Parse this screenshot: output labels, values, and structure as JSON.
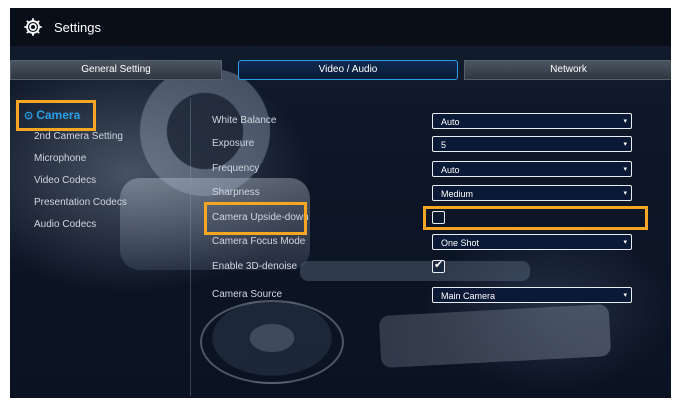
{
  "header": {
    "title": "Settings",
    "icon": "gear-icon"
  },
  "tabs": [
    {
      "label": "General Setting",
      "active": false
    },
    {
      "label": "Video / Audio",
      "active": true
    },
    {
      "label": "Network",
      "active": false
    }
  ],
  "sidebar": {
    "items": [
      {
        "label": "Camera",
        "active": true
      },
      {
        "label": "2nd Camera Setting",
        "active": false
      },
      {
        "label": "Microphone",
        "active": false
      },
      {
        "label": "Video Codecs",
        "active": false
      },
      {
        "label": "Presentation Codecs",
        "active": false
      },
      {
        "label": "Audio Codecs",
        "active": false
      }
    ]
  },
  "settings": [
    {
      "label": "White Balance",
      "type": "select",
      "value": "Auto"
    },
    {
      "label": "Exposure",
      "type": "select",
      "value": "5"
    },
    {
      "label": "Frequency",
      "type": "select",
      "value": "Auto"
    },
    {
      "label": "Sharpness",
      "type": "select",
      "value": "Medium"
    },
    {
      "label": "Camera Upside-down",
      "type": "checkbox",
      "checked": false
    },
    {
      "label": "Camera Focus Mode",
      "type": "select",
      "value": "One Shot"
    },
    {
      "label": "Enable 3D-denoise",
      "type": "checkbox",
      "checked": true
    },
    {
      "label": "Camera Source",
      "type": "select",
      "value": "Main Camera"
    }
  ],
  "colors": {
    "accent": "#2aa0e6",
    "highlight": "#f5a623",
    "background": "#0b1322"
  }
}
